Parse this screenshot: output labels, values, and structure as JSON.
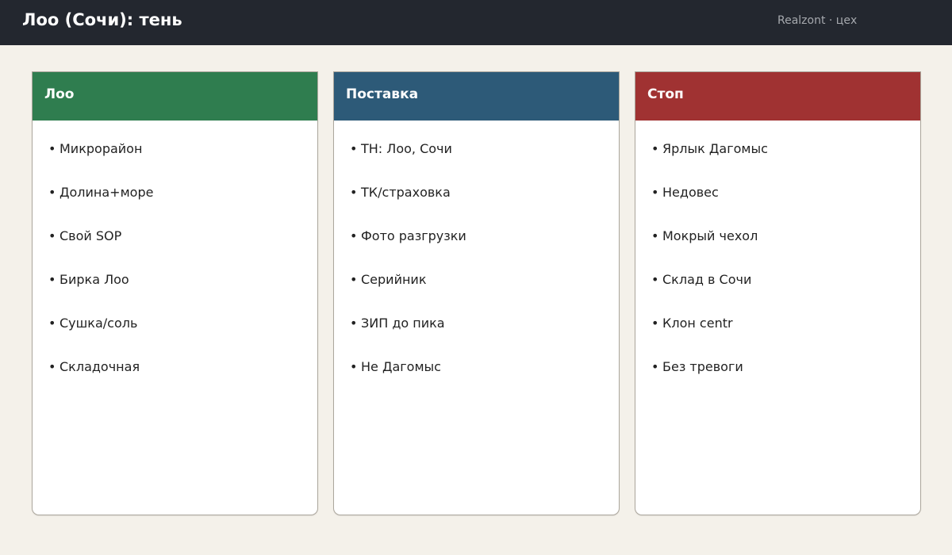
{
  "header": {
    "title": "Лоо (Сочи): тень",
    "meta": "Realzont · цех"
  },
  "colors": {
    "header_bg": "#23272f",
    "page_bg": "#f4f1ea",
    "col_green": "#2f7d4f",
    "col_blue": "#2d5a78",
    "col_red": "#a03232"
  },
  "columns": [
    {
      "title": "Лоо",
      "color": "#2f7d4f",
      "items": [
        "Микрорайон",
        "Долина+море",
        "Свой SOP",
        "Бирка Лоо",
        "Сушка/соль",
        "Складочная"
      ]
    },
    {
      "title": "Поставка",
      "color": "#2d5a78",
      "items": [
        "ТН: Лоо, Сочи",
        "ТК/страховка",
        "Фото разгрузки",
        "Серийник",
        "ЗИП до пика",
        "Не Дагомыс"
      ]
    },
    {
      "title": "Стоп",
      "color": "#a03232",
      "items": [
        "Ярлык Дагомыс",
        "Недовес",
        "Мокрый чехол",
        "Склад в Сочи",
        "Клон centr",
        "Без тревоги"
      ]
    }
  ]
}
